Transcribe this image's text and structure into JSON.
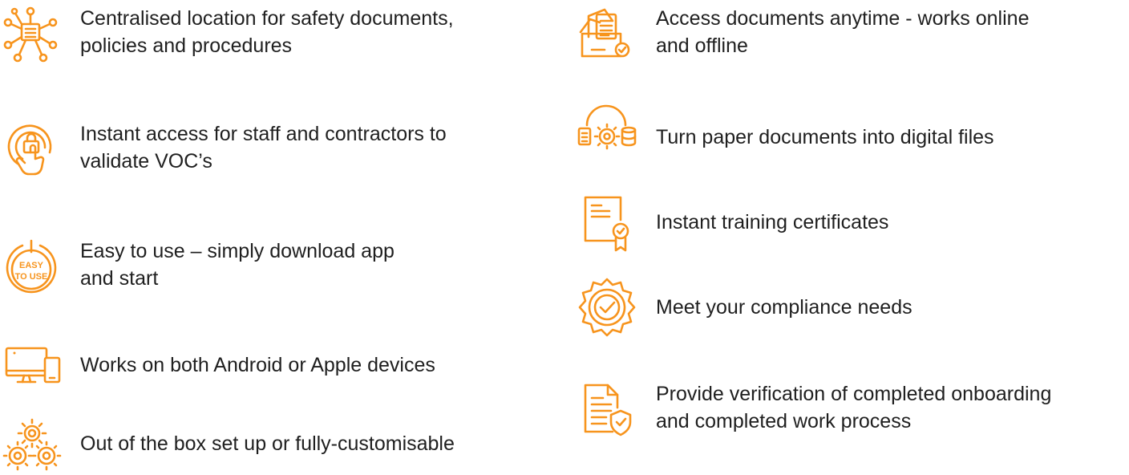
{
  "accent_color": "#f7941d",
  "left_features": [
    {
      "icon": "network-hub-icon",
      "text": "Centralised location for safety documents,\npolicies and procedures"
    },
    {
      "icon": "touch-access-icon",
      "text": "Instant access for staff and contractors to\nvalidate VOC’s"
    },
    {
      "icon": "easy-to-use-icon",
      "icon_text_1": "EASY",
      "icon_text_2": "TO USE",
      "text": "Easy to use – simply download app\nand start"
    },
    {
      "icon": "devices-icon",
      "text": "Works on both Android or Apple devices"
    },
    {
      "icon": "gears-icon",
      "text": "Out of the box set up or fully-customisable"
    }
  ],
  "right_features": [
    {
      "icon": "document-folder-icon",
      "text": "Access documents anytime - works online\nand offline"
    },
    {
      "icon": "digitise-icon",
      "text": "Turn paper documents into digital files"
    },
    {
      "icon": "certificate-icon",
      "text": "Instant training certificates"
    },
    {
      "icon": "compliance-badge-icon",
      "text": "Meet your compliance needs"
    },
    {
      "icon": "verified-document-icon",
      "text": "Provide verification of completed onboarding\nand completed work process"
    }
  ]
}
